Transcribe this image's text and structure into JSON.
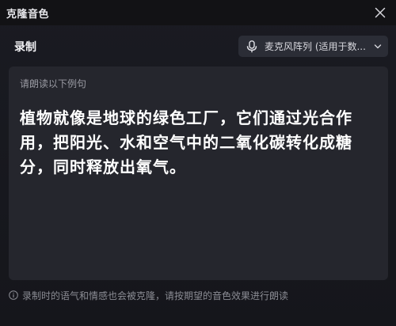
{
  "window": {
    "title": "克隆音色",
    "close_icon": "close-icon"
  },
  "record": {
    "section_label": "录制",
    "microphone": {
      "icon": "microphone-icon",
      "selected": "麦克风阵列 (适用于数...",
      "dropdown_icon": "chevron-down-icon"
    }
  },
  "prompt_card": {
    "label": "请朗读以下例句",
    "sentence": "植物就像是地球的绿色工厂，它们通过光合作用，把阳光、水和空气中的二氧化碳转化成糖分，同时释放出氧气。"
  },
  "hint": {
    "icon": "info-icon",
    "text": "录制时的语气和情感也会被克隆，请按期望的音色效果进行朗读"
  }
}
